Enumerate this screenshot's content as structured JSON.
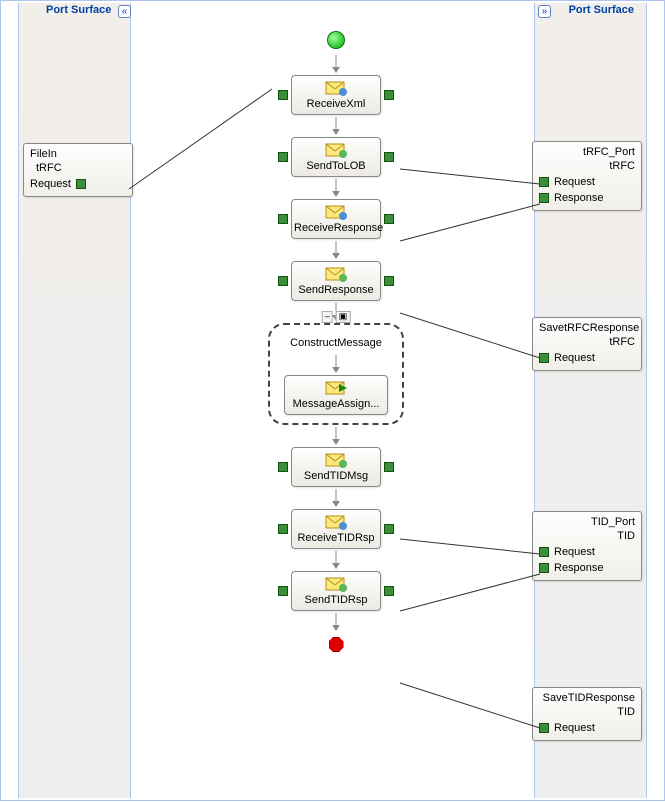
{
  "headers": {
    "left": "Port Surface",
    "right": "Port Surface"
  },
  "chevrons": {
    "left": "«",
    "right": "»"
  },
  "shapes": {
    "receiveXml": "ReceiveXml",
    "sendToLOB": "SendToLOB",
    "receiveResponse": "ReceiveResponse",
    "sendResponse": "SendResponse",
    "constructMessage": "ConstructMessage",
    "messageAssign": "MessageAssign...",
    "sendTIDMsg": "SendTIDMsg",
    "receiveTIDRsp": "ReceiveTIDRsp",
    "sendTIDRsp": "SendTIDRsp",
    "groupTabSmall": "–",
    "groupTabIcon": "▣"
  },
  "ports": {
    "fileIn": {
      "name": "FileIn",
      "type": "tRFC",
      "ops": [
        "Request"
      ]
    },
    "trfcPort": {
      "name": "tRFC_Port",
      "type": "tRFC",
      "ops": [
        "Request",
        "Response"
      ]
    },
    "saveTrfc": {
      "name": "SavetRFCResponse",
      "type": "tRFC",
      "ops": [
        "Request"
      ]
    },
    "tidPort": {
      "name": "TID_Port",
      "type": "TID",
      "ops": [
        "Request",
        "Response"
      ]
    },
    "saveTid": {
      "name": "SaveTIDResponse",
      "type": "TID",
      "ops": [
        "Request"
      ]
    }
  }
}
